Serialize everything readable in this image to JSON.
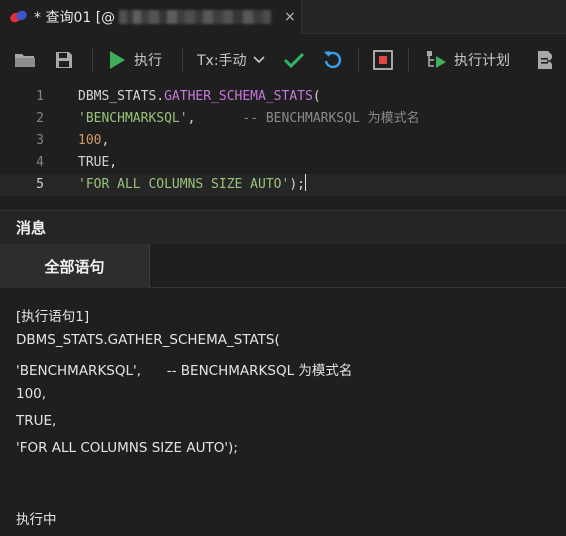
{
  "tab": {
    "title": "* 查询01 [@",
    "close_label": "×"
  },
  "toolbar": {
    "execute_label": "执行",
    "tx_mode_label": "Tx:手动",
    "plan_label": "执行计划"
  },
  "editor": {
    "lines": [
      {
        "number": "1"
      },
      {
        "number": "2"
      },
      {
        "number": "3"
      },
      {
        "number": "4"
      },
      {
        "number": "5"
      }
    ],
    "l1_pkg": "DBMS_STATS.",
    "l1_fn": "GATHER_SCHEMA_STATS",
    "l1_paren": "(",
    "l2_str": "'BENCHMARKSQL'",
    "l2_comma": ",      ",
    "l2_comment": "-- BENCHMARKSQL 为模式名",
    "l3_num": "100",
    "l3_comma": ",",
    "l4_text": "TRUE,",
    "l5_str": "'FOR ALL COLUMNS SIZE AUTO'",
    "l5_end": ");"
  },
  "messages": {
    "header": "消息",
    "tab_all": "全部语句",
    "output": [
      "[执行语句1]",
      "DBMS_STATS.GATHER_SCHEMA_STATS(",
      "'BENCHMARKSQL',      -- BENCHMARKSQL 为模式名",
      "100,",
      "TRUE,",
      "'FOR ALL COLUMNS SIZE AUTO');",
      "",
      "执行中"
    ]
  },
  "colors": {
    "background": "#1f1f1f",
    "keyword": "#c678dd",
    "string": "#98c379",
    "number": "#d19a66",
    "execute_green": "#3fae5c",
    "commit_green": "#2fb56a",
    "rollback_blue": "#3aa0e8",
    "stop_red": "#e04848"
  }
}
